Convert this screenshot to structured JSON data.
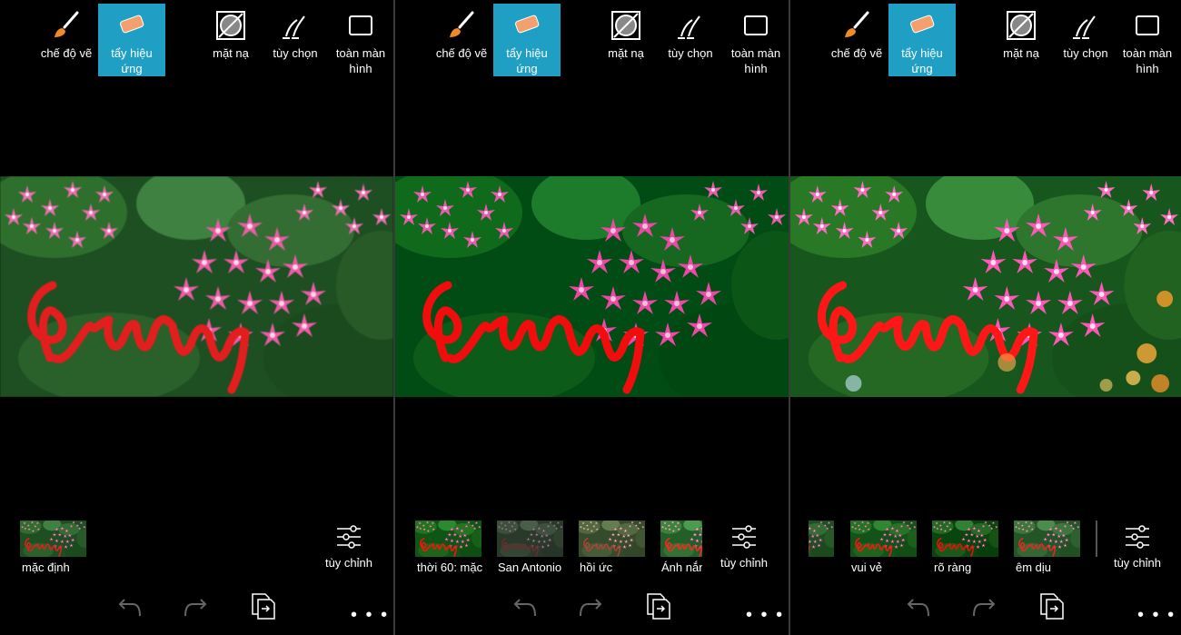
{
  "toolbar": {
    "draw_mode": "chế độ vẽ",
    "erase_effect_line1": "tẩy hiệu",
    "erase_effect_line2": "ứng",
    "mask": "mặt nạ",
    "options": "tùy chọn",
    "fullscreen_line1": "toàn màn",
    "fullscreen_line2": "hình"
  },
  "colors": {
    "accent": "#1f9fc4",
    "flower_pink": "#ee5aa8",
    "leaf_green": "#2b6b2a",
    "handwriting_red": "#e31e1e"
  },
  "filters": {
    "settings_label": "tùy chỉnh",
    "panel1": [
      "mặc định"
    ],
    "panel2": [
      "thời 60: mặc",
      "San Antonio",
      "hồi ức",
      "Ánh nắng"
    ],
    "panel3": [
      "",
      "vui vẻ",
      "rõ ràng",
      "êm dịu"
    ]
  },
  "icons": {
    "draw": "paintbrush-icon",
    "erase": "eraser-icon",
    "mask": "mask-icon",
    "options": "brush-options-icon",
    "fullscreen": "fullscreen-icon",
    "undo": "undo-icon",
    "redo": "redo-icon",
    "compare": "compare-icon",
    "settings": "sliders-icon",
    "more": "more-icon"
  },
  "more_label": "• • •"
}
